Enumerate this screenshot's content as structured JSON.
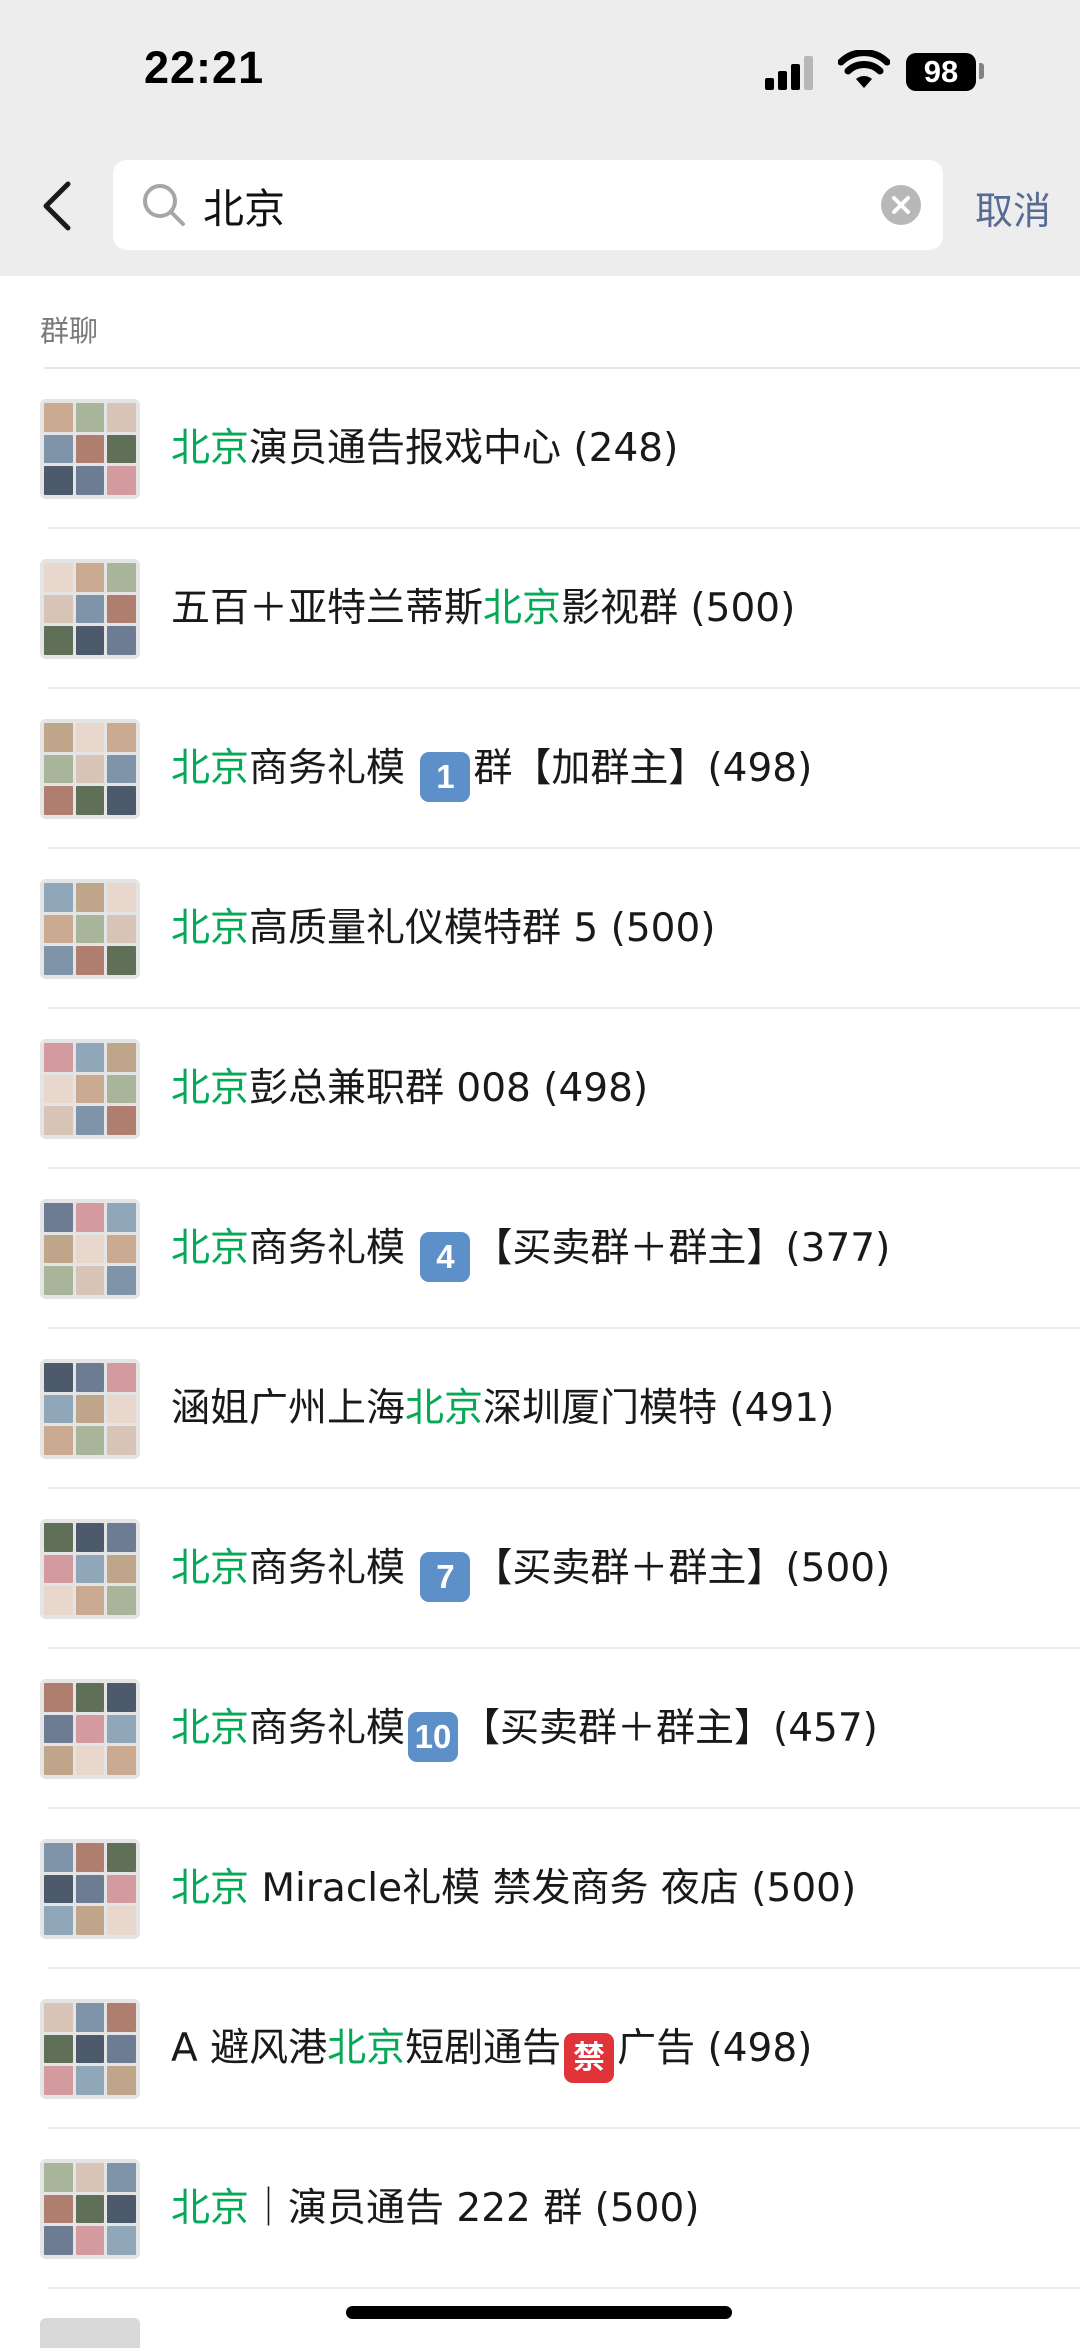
{
  "status_bar": {
    "time": "22:21",
    "battery": "98"
  },
  "search": {
    "query": "北京",
    "cancel_label": "取消"
  },
  "section": {
    "label": "群聊"
  },
  "colors": {
    "highlight": "#07a857",
    "link": "#576b95",
    "background": "#ededed"
  },
  "icons": [
    "back-chevron-icon",
    "search-icon",
    "clear-icon",
    "signal-icon",
    "wifi-icon",
    "battery-icon"
  ],
  "results": [
    {
      "parts": [
        {
          "t": "北京",
          "hl": true
        },
        {
          "t": "演员通告报戏中心 (248)"
        }
      ]
    },
    {
      "parts": [
        {
          "t": "五百＋亚特兰蒂斯"
        },
        {
          "t": "北京",
          "hl": true
        },
        {
          "t": "影视群 (500)"
        }
      ]
    },
    {
      "parts": [
        {
          "t": "北京",
          "hl": true
        },
        {
          "t": "商务礼模 "
        },
        {
          "t": "1",
          "badge": true
        },
        {
          "t": "群【加群主】(498)"
        }
      ]
    },
    {
      "parts": [
        {
          "t": "北京",
          "hl": true
        },
        {
          "t": "高质量礼仪模特群 5 (500)"
        }
      ]
    },
    {
      "parts": [
        {
          "t": "北京",
          "hl": true
        },
        {
          "t": "彭总兼职群 008 (498)"
        }
      ]
    },
    {
      "parts": [
        {
          "t": "北京",
          "hl": true
        },
        {
          "t": "商务礼模 "
        },
        {
          "t": "4",
          "badge": true
        },
        {
          "t": "【买卖群＋群主】(377)"
        }
      ]
    },
    {
      "parts": [
        {
          "t": "涵姐广州上海"
        },
        {
          "t": "北京",
          "hl": true
        },
        {
          "t": "深圳厦门模特 (491)"
        }
      ]
    },
    {
      "parts": [
        {
          "t": "北京",
          "hl": true
        },
        {
          "t": "商务礼模 "
        },
        {
          "t": "7",
          "badge": true
        },
        {
          "t": "【买卖群＋群主】(500)"
        }
      ]
    },
    {
      "parts": [
        {
          "t": "北京",
          "hl": true
        },
        {
          "t": "商务礼模"
        },
        {
          "t": "10",
          "badge": true
        },
        {
          "t": "【买卖群＋群主】(457)"
        }
      ]
    },
    {
      "parts": [
        {
          "t": "北京",
          "hl": true
        },
        {
          "t": " Miracle礼模 禁发商务 夜店 (500)"
        }
      ]
    },
    {
      "parts": [
        {
          "t": "A 避风港"
        },
        {
          "t": "北京",
          "hl": true
        },
        {
          "t": "短剧通告"
        },
        {
          "t": "禁",
          "badge": true,
          "red": true
        },
        {
          "t": "广告 (498)"
        }
      ]
    },
    {
      "parts": [
        {
          "t": "北京",
          "hl": true
        },
        {
          "t": "｜演员通告 222 群 (500)"
        }
      ]
    }
  ]
}
